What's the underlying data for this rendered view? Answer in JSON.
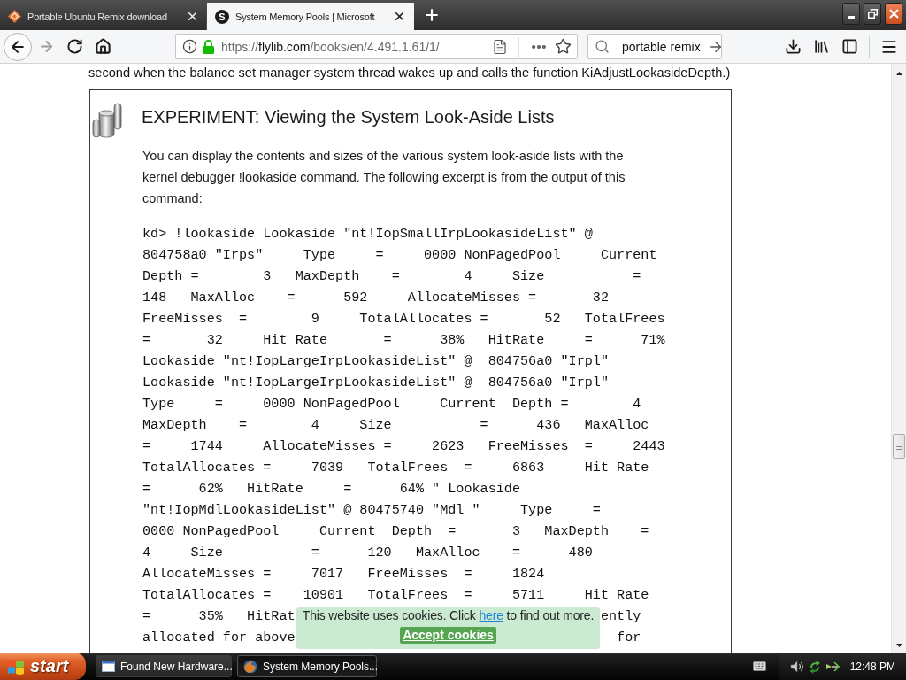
{
  "browser": {
    "tabs": [
      {
        "title": "Portable Ubuntu Remix download",
        "selected": false,
        "favicon": {
          "kind": "diamond"
        }
      },
      {
        "title": "System Memory Pools | Microsoft",
        "selected": true,
        "favicon": {
          "kind": "letter",
          "text": "S"
        }
      }
    ],
    "nav_buttons": [
      {
        "kind": "back",
        "disabled": false
      },
      {
        "kind": "forward",
        "disabled": true
      },
      {
        "kind": "reload",
        "disabled": false
      },
      {
        "kind": "home",
        "disabled": false
      }
    ],
    "address": {
      "scheme": "https://",
      "host": "flylib.com",
      "path": "/books/en/4.491.1.61/1/",
      "secure": true
    },
    "search": {
      "value": "portable remix"
    }
  },
  "page": {
    "lead_text": "second when the balance set manager system thread wakes up and calls the function KiAdjustLookasideDepth.)",
    "experiment": {
      "title": "EXPERIMENT: Viewing the System Look-Aside Lists",
      "intro": "You can display the contents and sizes of the various system look-aside lists with the kernel debugger !lookaside command. The following excerpt is from the output of this command:",
      "code_lines": [
        {
          "text": "kd> !lookaside Lookaside \"nt!IopSmallIrpLookasideList\" @"
        },
        {
          "text": "804758a0 \"Irps\"     Type     =     0000 NonPagedPool     Current"
        },
        {
          "text": "Depth =        3   MaxDepth    =        4     Size           ="
        },
        {
          "text": "148   MaxAlloc    =      592     AllocateMisses =       32"
        },
        {
          "text": "FreeMisses  =        9     TotalAllocates =       52   TotalFrees"
        },
        {
          "text": "=       32     Hit Rate       =      38%   HitRate     =      71%"
        },
        {
          "text": "Lookaside \"nt!IopLargeIrpLookasideList\" @  804756a0 \"Irpl\""
        },
        {
          "text": "Lookaside \"nt!IopLargeIrpLookasideList\" @  804756a0 \"Irpl\""
        },
        {
          "text": "Type     =     0000 NonPagedPool     Current  Depth =        4"
        },
        {
          "text": "MaxDepth    =        4     Size           =      436   MaxAlloc"
        },
        {
          "text": "=     1744     AllocateMisses =     2623   FreeMisses  =     2443"
        },
        {
          "text": "TotalAllocates =     7039   TotalFrees  =     6863     Hit Rate"
        },
        {
          "text": "=      62%   HitRate     =      64% \" Lookaside"
        },
        {
          "text": "\"nt!IopMdlLookasideList\" @ 80475740 \"Mdl \"     Type     ="
        },
        {
          "text": "0000 NonPagedPool     Current  Depth  =       3   MaxDepth    ="
        },
        {
          "text": "4     Size           =      120   MaxAlloc    =      480"
        },
        {
          "text": "AllocateMisses =     7017   FreeMisses  =     1824"
        },
        {
          "text": "TotalAllocates =    10901   TotalFrees  =     5711     Hit Rate"
        },
        {
          "text": "=      35%   HitRat",
          "tail": "ently"
        },
        {
          "text": "allocated for above",
          "tail": "for"
        }
      ]
    },
    "cookie_banner": {
      "text_before": "This website uses cookies. Click",
      "link": "here",
      "text_after": "to find out more.",
      "button": "Accept cookies"
    }
  },
  "taskbar": {
    "start": "start",
    "buttons": [
      {
        "label": "Found New Hardware...",
        "selected": false,
        "kind": "window"
      },
      {
        "label": "System Memory Pools...",
        "selected": true,
        "kind": "browser"
      }
    ],
    "clock": "12:48 PM"
  }
}
